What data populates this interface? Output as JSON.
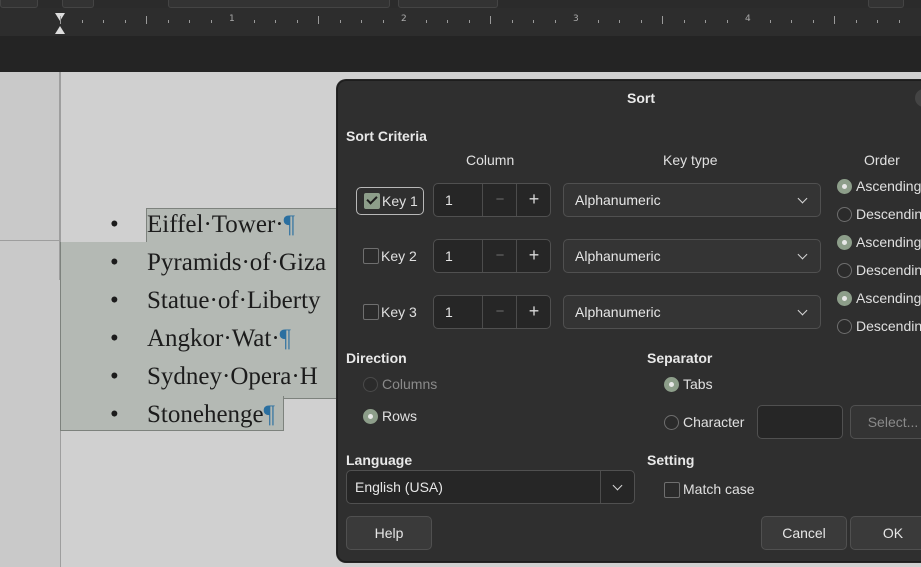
{
  "ruler": {
    "numbers": [
      "1",
      "2",
      "3",
      "4"
    ]
  },
  "document": {
    "bullet": "•",
    "items": [
      {
        "text": "Eiffel·Tower·",
        "mark": "¶"
      },
      {
        "text": "Pyramids·of·Giza",
        "mark": ""
      },
      {
        "text": "Statue·of·Liberty",
        "mark": ""
      },
      {
        "text": "Angkor·Wat·",
        "mark": "¶"
      },
      {
        "text": "Sydney·Opera·H",
        "mark": ""
      },
      {
        "text": "Stonehenge",
        "mark": "¶"
      }
    ]
  },
  "dialog": {
    "title": "Sort",
    "sort_criteria": "Sort Criteria",
    "headers": {
      "column": "Column",
      "key_type": "Key type",
      "order": "Order"
    },
    "keys": [
      {
        "label": "Key 1",
        "checked": true,
        "column": "1",
        "minus": "−",
        "plus": "+",
        "key_type": "Alphanumeric",
        "ascending": "Ascending",
        "descending": "Descending",
        "order": "ascending"
      },
      {
        "label": "Key 2",
        "checked": false,
        "column": "1",
        "minus": "−",
        "plus": "+",
        "key_type": "Alphanumeric",
        "ascending": "Ascending",
        "descending": "Descending",
        "order": "ascending"
      },
      {
        "label": "Key 3",
        "checked": false,
        "column": "1",
        "minus": "−",
        "plus": "+",
        "key_type": "Alphanumeric",
        "ascending": "Ascending",
        "descending": "Descending",
        "order": "ascending"
      }
    ],
    "direction": {
      "label": "Direction",
      "columns": "Columns",
      "rows": "Rows",
      "selected": "rows"
    },
    "separator": {
      "label": "Separator",
      "tabs": "Tabs",
      "character": "Character",
      "character_value": "",
      "select_button": "Select...",
      "selected": "tabs"
    },
    "language": {
      "label": "Language",
      "value": "English (USA)"
    },
    "setting": {
      "label": "Setting",
      "match_case": "Match case",
      "match_case_checked": false
    },
    "buttons": {
      "help": "Help",
      "cancel": "Cancel",
      "ok": "OK"
    }
  },
  "colors": {
    "accent": "#8d9e8a",
    "pilcrow": "#2a6fa0",
    "dialog_bg": "#2f2f2f"
  }
}
